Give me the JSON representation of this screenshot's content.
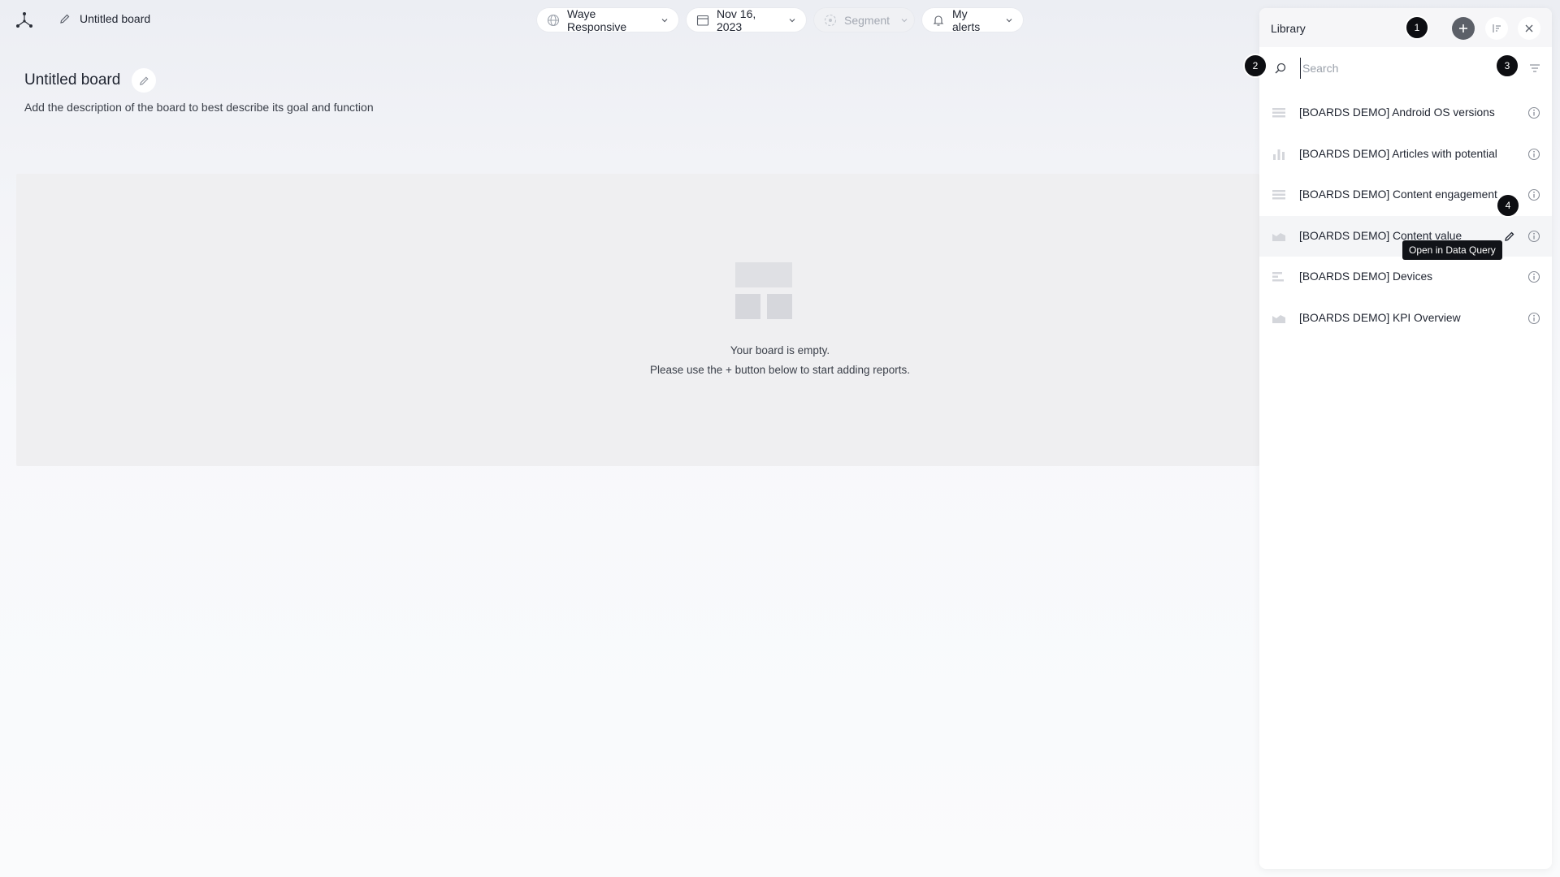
{
  "topbar": {
    "board_name": "Untitled board",
    "filters": [
      {
        "label": "Waye Responsive",
        "icon": "globe-icon"
      },
      {
        "label": "Nov 16, 2023",
        "icon": "calendar-icon"
      },
      {
        "label": "Segment",
        "icon": "segment-icon",
        "disabled": true
      },
      {
        "label": "My alerts",
        "icon": "bell-icon"
      }
    ]
  },
  "board": {
    "title": "Untitled board",
    "description": "Add the description of the board to best describe its goal and function",
    "empty_line1": "Your board is empty.",
    "empty_line2": "Please use the + button below to start adding reports."
  },
  "library": {
    "title": "Library",
    "search_placeholder": "Search",
    "items": [
      {
        "label": "[BOARDS DEMO] Android OS versions",
        "icon": "table-icon"
      },
      {
        "label": "[BOARDS DEMO] Articles with potential",
        "icon": "bar-chart-icon"
      },
      {
        "label": "[BOARDS DEMO] Content engagement",
        "icon": "table-icon"
      },
      {
        "label": "[BOARDS DEMO] Content value",
        "icon": "area-chart-icon"
      },
      {
        "label": "[BOARDS DEMO] Devices",
        "icon": "horizontal-bar-icon"
      },
      {
        "label": "[BOARDS DEMO] KPI Overview",
        "icon": "area-chart-icon"
      }
    ],
    "tooltip": "Open in Data Query"
  },
  "markers": [
    "1",
    "2",
    "3",
    "4"
  ],
  "colors": {
    "accent_dark": "#0d0e12",
    "panel_bg": "#ffffff",
    "board_bg": "#efeff1"
  }
}
